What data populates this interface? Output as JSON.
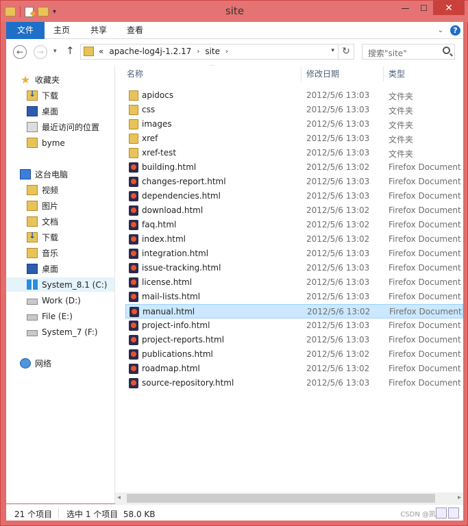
{
  "window": {
    "title": "site",
    "close_glyph": "✕",
    "minimize_glyph": "—",
    "maximize_glyph": "☐"
  },
  "ribbon": {
    "tabs": [
      "文件",
      "主页",
      "共享",
      "查看"
    ]
  },
  "address": {
    "crumbs": [
      "apache-log4j-1.2.17",
      "site"
    ],
    "overflow": "«",
    "search_placeholder": "搜索\"site\""
  },
  "nav_pane": {
    "items": [
      {
        "label": "收藏夹",
        "icon": "star-icon"
      },
      {
        "label": "下载",
        "icon": "downloads-folder-icon"
      },
      {
        "label": "桌面",
        "icon": "desktop-icon"
      },
      {
        "label": "最近访问的位置",
        "icon": "recent-places-icon"
      },
      {
        "label": "byme",
        "icon": "folder-icon"
      },
      {
        "label": "这台电脑",
        "icon": "computer-icon"
      },
      {
        "label": "视频",
        "icon": "videos-folder-icon"
      },
      {
        "label": "图片",
        "icon": "pictures-folder-icon"
      },
      {
        "label": "文档",
        "icon": "documents-folder-icon"
      },
      {
        "label": "下载",
        "icon": "downloads-folder-icon"
      },
      {
        "label": "音乐",
        "icon": "music-folder-icon"
      },
      {
        "label": "桌面",
        "icon": "desktop-folder-icon"
      },
      {
        "label": "System_8.1 (C:)",
        "icon": "windows-drive-icon"
      },
      {
        "label": "Work (D:)",
        "icon": "drive-icon"
      },
      {
        "label": "File (E:)",
        "icon": "drive-icon"
      },
      {
        "label": "System_7 (F:)",
        "icon": "drive-icon"
      },
      {
        "label": "网络",
        "icon": "network-icon"
      }
    ]
  },
  "columns": {
    "name": "名称",
    "date": "修改日期",
    "type": "类型"
  },
  "files": [
    {
      "name": "apidocs",
      "date": "2012/5/6 13:03",
      "type": "文件夹",
      "kind": "folder"
    },
    {
      "name": "css",
      "date": "2012/5/6 13:03",
      "type": "文件夹",
      "kind": "folder"
    },
    {
      "name": "images",
      "date": "2012/5/6 13:03",
      "type": "文件夹",
      "kind": "folder"
    },
    {
      "name": "xref",
      "date": "2012/5/6 13:03",
      "type": "文件夹",
      "kind": "folder"
    },
    {
      "name": "xref-test",
      "date": "2012/5/6 13:03",
      "type": "文件夹",
      "kind": "folder"
    },
    {
      "name": "building.html",
      "date": "2012/5/6 13:02",
      "type": "Firefox Document",
      "kind": "html"
    },
    {
      "name": "changes-report.html",
      "date": "2012/5/6 13:03",
      "type": "Firefox Document",
      "kind": "html"
    },
    {
      "name": "dependencies.html",
      "date": "2012/5/6 13:03",
      "type": "Firefox Document",
      "kind": "html"
    },
    {
      "name": "download.html",
      "date": "2012/5/6 13:02",
      "type": "Firefox Document",
      "kind": "html"
    },
    {
      "name": "faq.html",
      "date": "2012/5/6 13:02",
      "type": "Firefox Document",
      "kind": "html"
    },
    {
      "name": "index.html",
      "date": "2012/5/6 13:02",
      "type": "Firefox Document",
      "kind": "html"
    },
    {
      "name": "integration.html",
      "date": "2012/5/6 13:03",
      "type": "Firefox Document",
      "kind": "html"
    },
    {
      "name": "issue-tracking.html",
      "date": "2012/5/6 13:03",
      "type": "Firefox Document",
      "kind": "html"
    },
    {
      "name": "license.html",
      "date": "2012/5/6 13:03",
      "type": "Firefox Document",
      "kind": "html"
    },
    {
      "name": "mail-lists.html",
      "date": "2012/5/6 13:03",
      "type": "Firefox Document",
      "kind": "html"
    },
    {
      "name": "manual.html",
      "date": "2012/5/6 13:02",
      "type": "Firefox Document",
      "kind": "html",
      "selected": true
    },
    {
      "name": "project-info.html",
      "date": "2012/5/6 13:03",
      "type": "Firefox Document",
      "kind": "html"
    },
    {
      "name": "project-reports.html",
      "date": "2012/5/6 13:03",
      "type": "Firefox Document",
      "kind": "html"
    },
    {
      "name": "publications.html",
      "date": "2012/5/6 13:02",
      "type": "Firefox Document",
      "kind": "html"
    },
    {
      "name": "roadmap.html",
      "date": "2012/5/6 13:02",
      "type": "Firefox Document",
      "kind": "html"
    },
    {
      "name": "source-repository.html",
      "date": "2012/5/6 13:03",
      "type": "Firefox Document",
      "kind": "html"
    }
  ],
  "status": {
    "item_count": "21 个项目",
    "selection": "选中 1 个项目  58.0 KB",
    "watermark": "CSDN @凯"
  },
  "colors": {
    "title_bar": "#e57373",
    "accent": "#1e6fc8",
    "selection": "#cce8ff"
  }
}
